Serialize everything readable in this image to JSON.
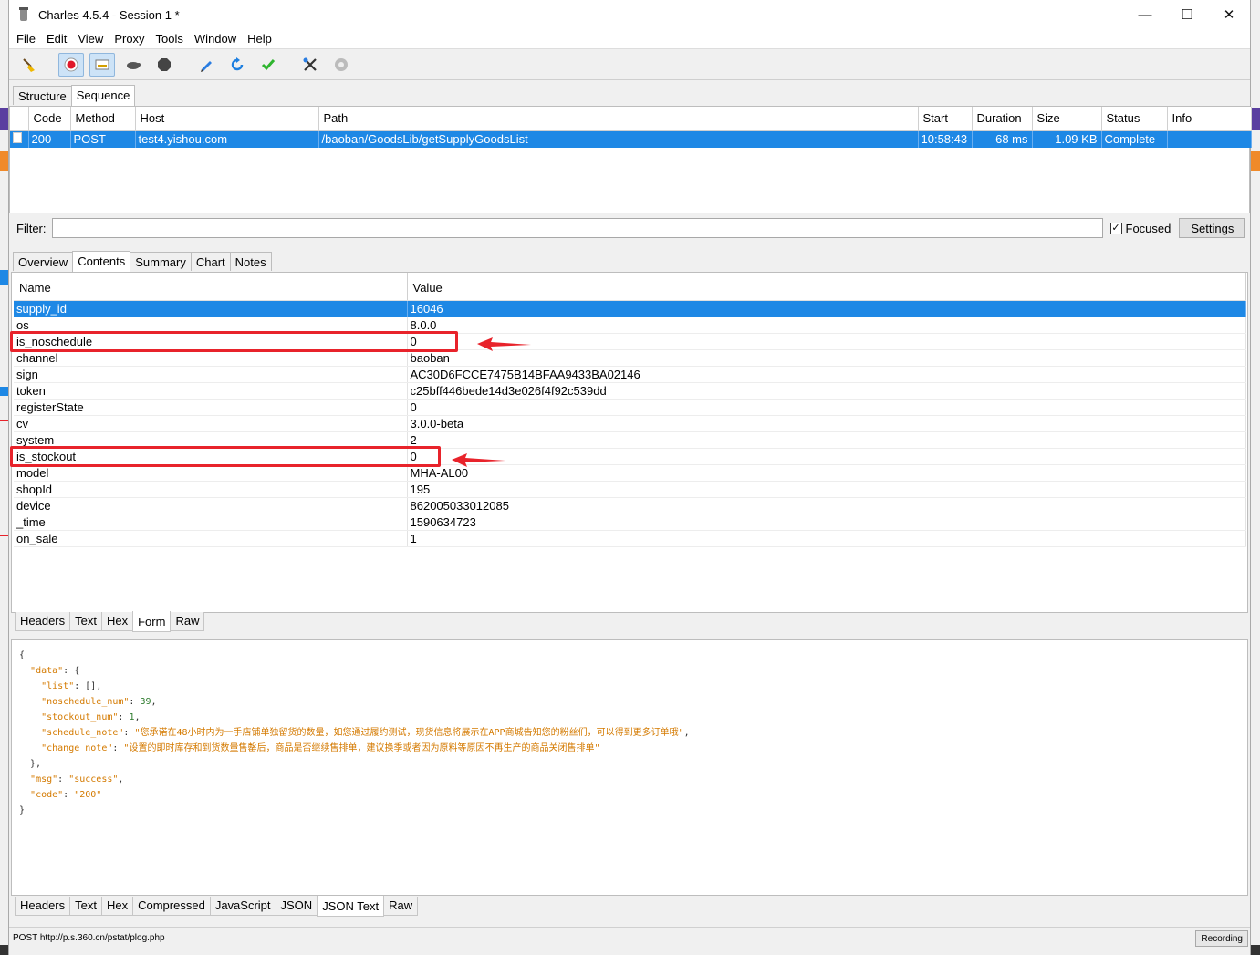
{
  "window": {
    "title": "Charles 4.5.4 - Session 1 *"
  },
  "menu": [
    "File",
    "Edit",
    "View",
    "Proxy",
    "Tools",
    "Window",
    "Help"
  ],
  "top_tabs": [
    "Structure",
    "Sequence"
  ],
  "sequence": {
    "columns": [
      "Code",
      "Method",
      "Host",
      "Path",
      "Start",
      "Duration",
      "Size",
      "Status",
      "Info"
    ],
    "rows": [
      {
        "code": "200",
        "method": "POST",
        "host": "test4.yishou.com",
        "path": "/baoban/GoodsLib/getSupplyGoodsList",
        "start": "10:58:43",
        "duration": "68 ms",
        "size": "1.09 KB",
        "status": "Complete",
        "info": ""
      }
    ]
  },
  "filter": {
    "label": "Filter:",
    "value": "",
    "focused_label": "Focused",
    "settings_label": "Settings"
  },
  "detail_tabs": [
    "Overview",
    "Contents",
    "Summary",
    "Chart",
    "Notes"
  ],
  "form": {
    "columns": [
      "Name",
      "Value"
    ],
    "rows": [
      {
        "name": "supply_id",
        "value": "16046"
      },
      {
        "name": "os",
        "value": "8.0.0"
      },
      {
        "name": "is_noschedule",
        "value": "0"
      },
      {
        "name": "channel",
        "value": "baoban"
      },
      {
        "name": "sign",
        "value": "AC30D6FCCE7475B14BFAA9433BA02146"
      },
      {
        "name": "token",
        "value": "c25bff446bede14d3e026f4f92c539dd"
      },
      {
        "name": "registerState",
        "value": "0"
      },
      {
        "name": "cv",
        "value": "3.0.0-beta"
      },
      {
        "name": "system",
        "value": "2"
      },
      {
        "name": "is_stockout",
        "value": "0"
      },
      {
        "name": "model",
        "value": "MHA-AL00"
      },
      {
        "name": "shopId",
        "value": "195"
      },
      {
        "name": "device",
        "value": "862005033012085"
      },
      {
        "name": "_time",
        "value": "1590634723"
      },
      {
        "name": "on_sale",
        "value": "1"
      }
    ]
  },
  "request_tabs": [
    "Headers",
    "Text",
    "Hex",
    "Form",
    "Raw"
  ],
  "response_json": {
    "open_brace": "{",
    "data_key": "\"data\"",
    "list_key": "\"list\"",
    "list_val": "[]",
    "noschedule_key": "\"noschedule_num\"",
    "noschedule_val": "39",
    "stockout_key": "\"stockout_num\"",
    "stockout_val": "1",
    "schedule_note_key": "\"schedule_note\"",
    "schedule_note_val": "\"您承诺在48小时内为一手店铺单独留货的数量，如您通过履约测试，现货信息将展示在APP商城告知您的粉丝们，可以得到更多订单哦\"",
    "change_note_key": "\"change_note\"",
    "change_note_val": "\"设置的即时库存和到货数量售罄后，商品是否继续售排单，建议换季或者因为原料等原因不再生产的商品关闭售排单\"",
    "msg_key": "\"msg\"",
    "msg_val": "\"success\"",
    "code_key": "\"code\"",
    "code_val": "\"200\"",
    "close_brace": "}"
  },
  "response_tabs": [
    "Headers",
    "Text",
    "Hex",
    "Compressed",
    "JavaScript",
    "JSON",
    "JSON Text",
    "Raw"
  ],
  "status": {
    "text": "POST http://p.s.360.cn/pstat/plog.php",
    "recording": "Recording"
  },
  "colors": {
    "selection": "#1e88e5",
    "annotation": "#e8232b"
  }
}
